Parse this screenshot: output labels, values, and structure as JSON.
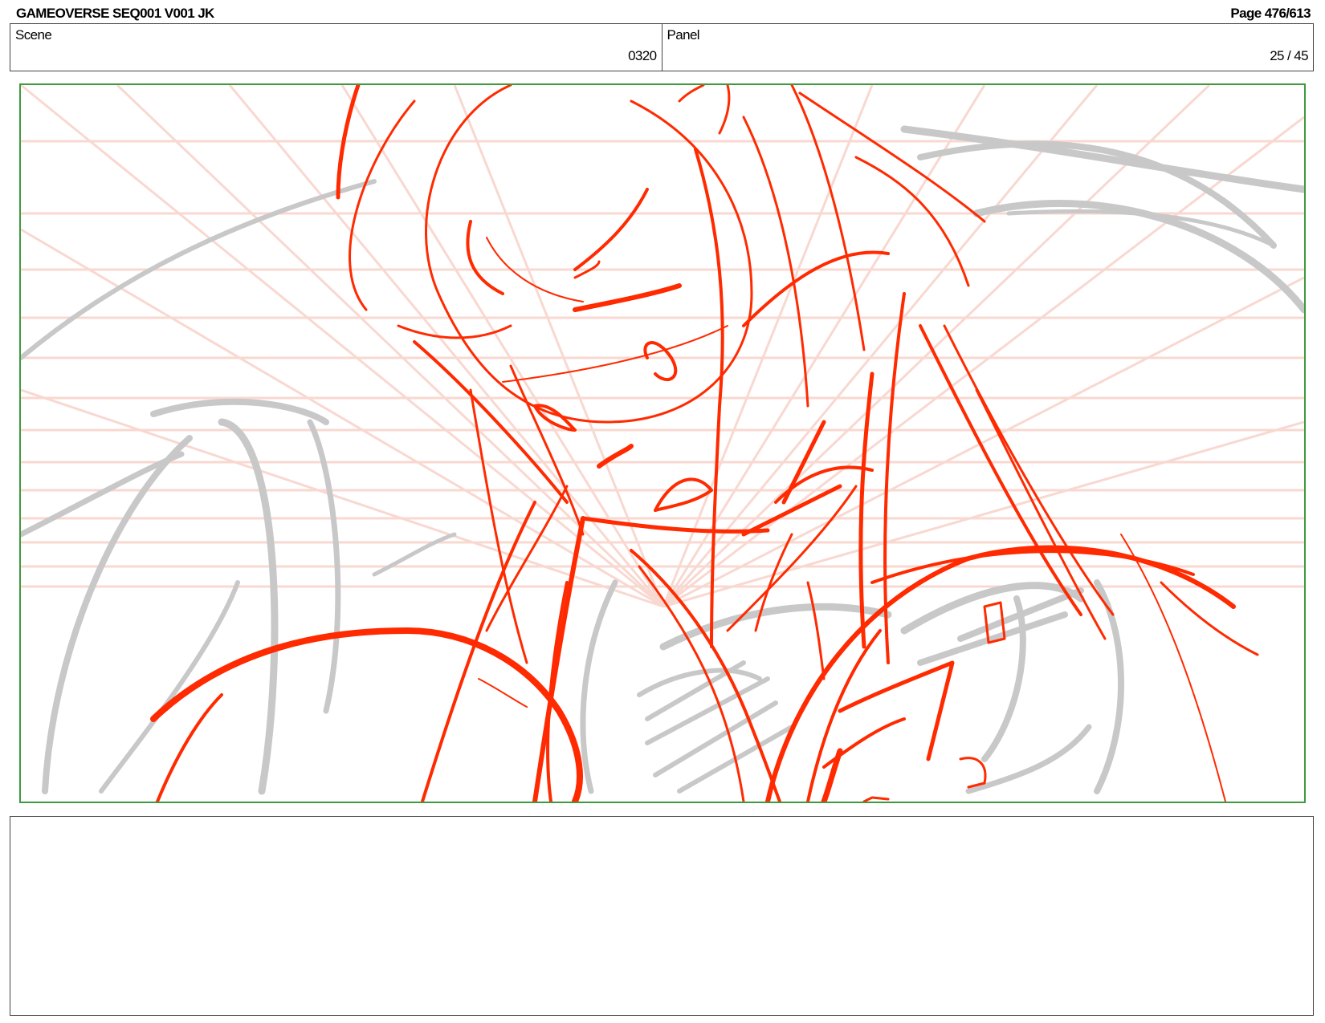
{
  "header": {
    "title": "GAMEOVERSE SEQ001 V001 JK",
    "page": "Page 476/613"
  },
  "info": {
    "scene_label": "Scene",
    "scene_value": "0320",
    "panel_label": "Panel",
    "panel_value": "25 / 45"
  },
  "colors": {
    "frame_border": "#3f9a3f",
    "sketch_red": "#ff2a00",
    "sketch_gray": "#c8c8c8",
    "grid_pink": "#f7c4b8"
  }
}
